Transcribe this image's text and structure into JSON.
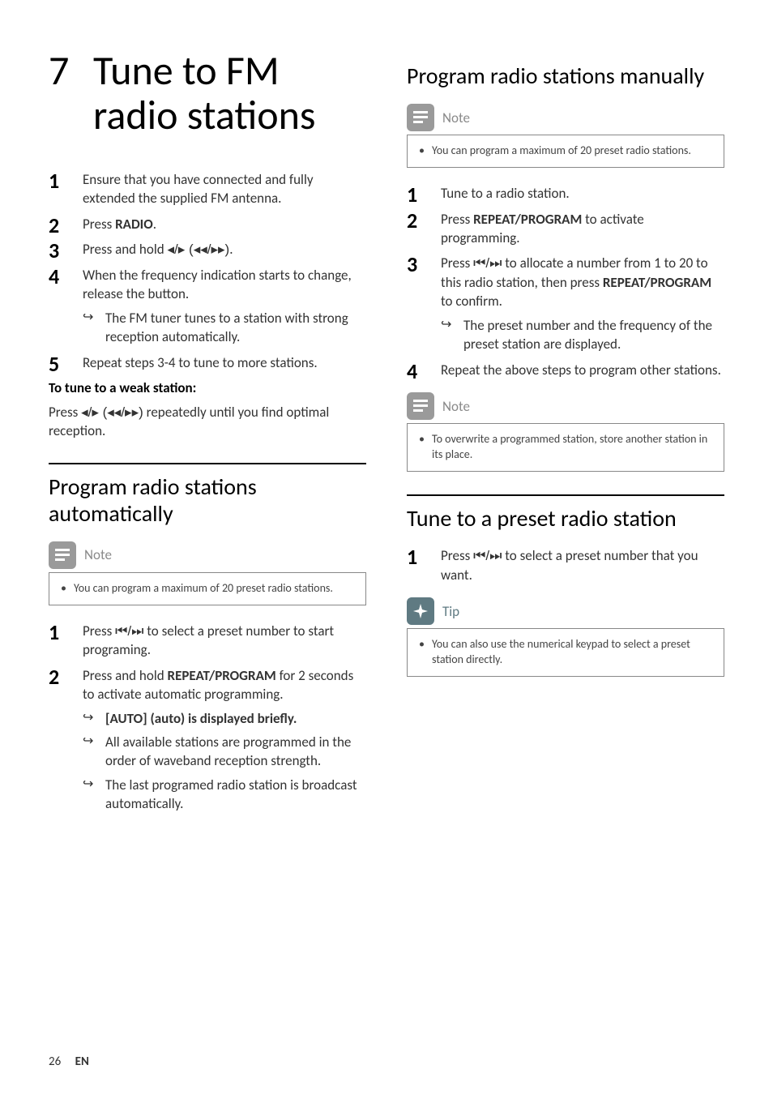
{
  "chapter": {
    "number": "7",
    "title": "Tune to FM radio stations"
  },
  "left": {
    "steps": [
      {
        "text_a": "Ensure that you have connected and fully extended the supplied FM antenna."
      },
      {
        "text_a": "Press ",
        "bold1": "RADIO",
        "text_b": "."
      },
      {
        "text_a": "Press and hold ",
        "glyph": "◂/▸ (◂◂/▸▸)",
        "text_b": "."
      },
      {
        "text_a": "When the frequency indication starts to change, release the button.",
        "sub": [
          "The FM tuner tunes to a station with strong reception automatically."
        ]
      },
      {
        "text_a": "Repeat steps 3-4 to tune to more stations."
      }
    ],
    "weak_title": "To tune to a weak station:",
    "weak_a": "Press ",
    "weak_glyph": "◂/▸ (◂◂/▸▸)",
    "weak_b": " repeatedly until you find optimal reception.",
    "auto_heading": "Program radio stations automatically",
    "note1_label": "Note",
    "note1_items": [
      "You can program a maximum of 20 preset radio stations."
    ],
    "auto_steps": [
      {
        "text_a": "Press ",
        "glyph": "⏮/⏭",
        "text_b": " to select a preset number to start programing."
      },
      {
        "text_a": "Press and hold ",
        "bold1": "REPEAT/PROGRAM",
        "text_b": " for 2 seconds to activate automatic programming.",
        "sub": [
          "[AUTO] (auto) is displayed briefly.",
          "All available stations are programmed in the order of waveband reception strength.",
          "The last programed radio station is broadcast automatically."
        ],
        "sub_bold_first": true
      }
    ]
  },
  "right": {
    "manual_heading": "Program radio stations manually",
    "note2_label": "Note",
    "note2_items": [
      "You can program a maximum of 20 preset radio stations."
    ],
    "manual_steps": [
      {
        "text_a": "Tune to a radio station."
      },
      {
        "text_a": "Press ",
        "bold1": "REPEAT/PROGRAM",
        "text_b": " to activate programming."
      },
      {
        "text_a": "Press ",
        "glyph": "⏮/⏭",
        "text_b": " to allocate a number from 1 to 20 to this radio station, then press ",
        "bold2": "REPEAT/PROGRAM",
        "text_c": " to confirm.",
        "sub": [
          "The preset number and the frequency of the preset station are displayed."
        ]
      },
      {
        "text_a": "Repeat the above steps to program other stations."
      }
    ],
    "note3_label": "Note",
    "note3_items": [
      "To overwrite a programmed station, store another station in its place."
    ],
    "preset_heading": "Tune to a preset radio station",
    "preset_steps": [
      {
        "text_a": "Press ",
        "glyph": "⏮/⏭",
        "text_b": " to select a preset number that you want."
      }
    ],
    "tip_label": "Tip",
    "tip_items": [
      "You can also use the numerical keypad to select a preset station directly."
    ]
  },
  "footer": {
    "page": "26",
    "lang": "EN"
  }
}
